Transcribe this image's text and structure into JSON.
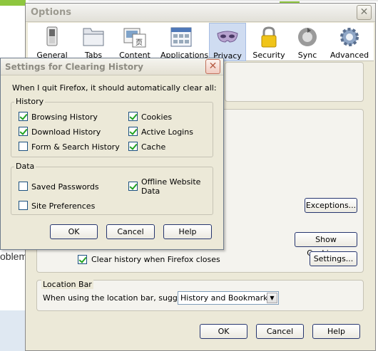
{
  "background": {
    "partial_text": "oblem"
  },
  "options": {
    "title": "Options",
    "close_glyph": "✕",
    "toolbar": [
      {
        "label": "General",
        "icon": "switch-icon"
      },
      {
        "label": "Tabs",
        "icon": "folder-tabs-icon"
      },
      {
        "label": "Content",
        "icon": "content-icon"
      },
      {
        "label": "Applications",
        "icon": "applications-icon"
      },
      {
        "label": "Privacy",
        "icon": "mask-icon",
        "active": true
      },
      {
        "label": "Security",
        "icon": "lock-icon"
      },
      {
        "label": "Sync",
        "icon": "sync-icon"
      },
      {
        "label": "Advanced",
        "icon": "gear-icon"
      }
    ],
    "exceptions_label": "Exceptions...",
    "show_cookies_label": "Show Cookies...",
    "clear_on_close_label": "Clear history when Firefox closes",
    "clear_on_close_checked": true,
    "settings_label": "Settings...",
    "location_bar": {
      "title": "Location Bar",
      "suggest_label": "When using the location bar, suggest:",
      "suggest_value": "History and Bookmarks"
    },
    "ok_label": "OK",
    "cancel_label": "Cancel",
    "help_label": "Help"
  },
  "dialog": {
    "title": "Settings for Clearing History",
    "close_glyph": "✕",
    "intro": "When I quit Firefox, it should automatically clear all:",
    "history_legend": "History",
    "history_items": [
      {
        "label": "Browsing History",
        "checked": true
      },
      {
        "label": "Download History",
        "checked": true
      },
      {
        "label": "Form & Search History",
        "checked": false
      },
      {
        "label": "Cookies",
        "checked": true
      },
      {
        "label": "Active Logins",
        "checked": true
      },
      {
        "label": "Cache",
        "checked": true
      }
    ],
    "data_legend": "Data",
    "data_items": [
      {
        "label": "Saved Passwords",
        "checked": false
      },
      {
        "label": "Site Preferences",
        "checked": false
      },
      {
        "label": "Offline Website Data",
        "checked": true
      }
    ],
    "ok_label": "OK",
    "cancel_label": "Cancel",
    "help_label": "Help"
  }
}
